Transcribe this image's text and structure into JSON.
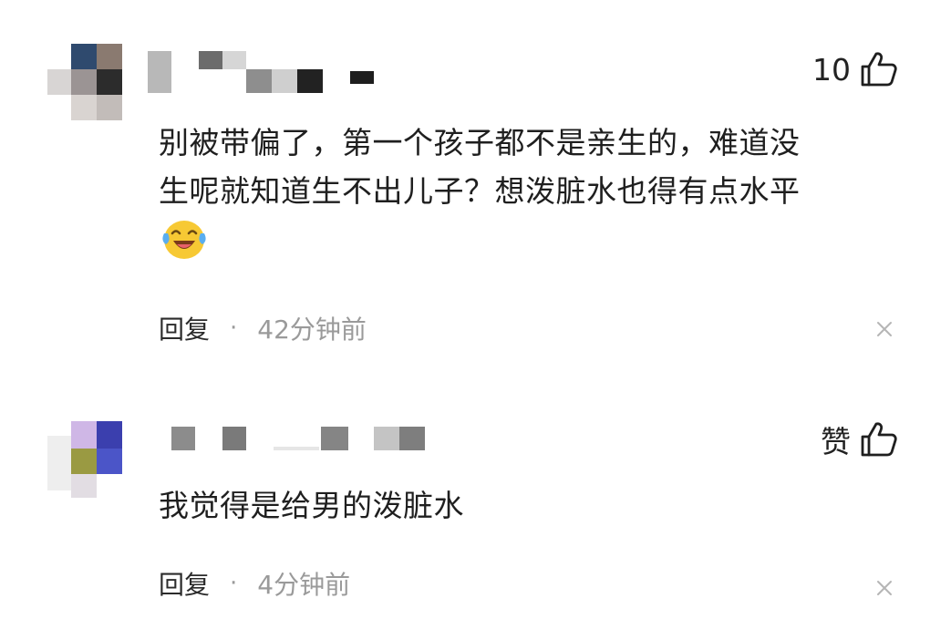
{
  "comments": [
    {
      "likes": "10",
      "text_line1": "别被带偏了，第一个孩子都不是亲生的，难道没",
      "text_line2": "生呢就知道生不出儿子？想泼脏水也得有点水平",
      "reply_label": "回复",
      "separator": "·",
      "time": "42分钟前",
      "emoji": "laughing-crying-emoji-icon"
    },
    {
      "likes": "赞",
      "text_line1": "我觉得是给男的泼脏水",
      "reply_label": "回复",
      "separator": "·",
      "time": "4分钟前"
    }
  ],
  "colors": {
    "text": "#1f1f1f",
    "meta_gray": "#9a9a9a",
    "emoji_yellow": "#f7c934",
    "emoji_tear": "#5aaef0"
  },
  "icons": [
    "thumbs-up-icon",
    "close-icon",
    "laughing-crying-emoji-icon"
  ]
}
